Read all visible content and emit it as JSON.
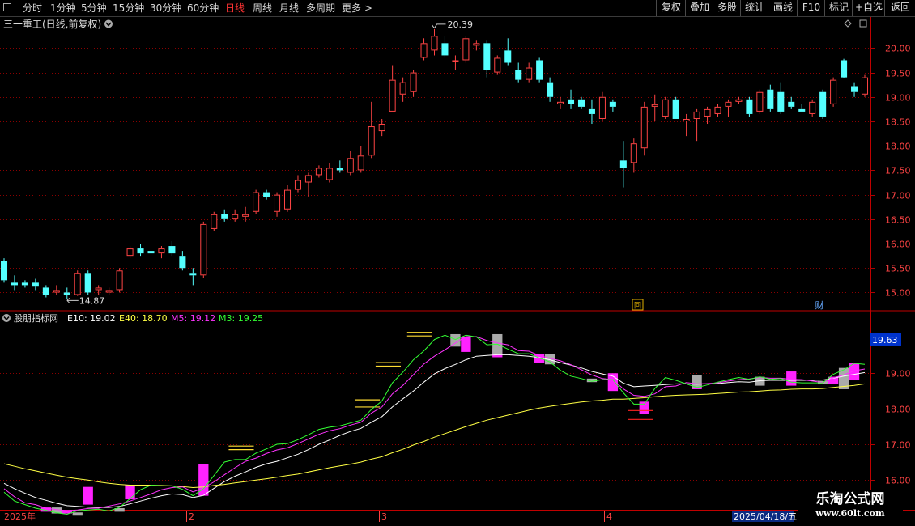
{
  "toolbar": {
    "left": [
      "分时",
      "1分钟",
      "5分钟",
      "15分钟",
      "30分钟",
      "60分钟",
      "日线",
      "周线",
      "月线",
      "多周期",
      "更多 >"
    ],
    "active": "日线",
    "right": [
      "复权",
      "叠加",
      "多股",
      "统计",
      "画线",
      "F10",
      "标记",
      "+自选",
      "返回"
    ]
  },
  "main_panel": {
    "title": "三一重工(日线,前复权)",
    "high_label": "20.39",
    "low_label": "14.87",
    "marker_left": "回",
    "marker_right": "财"
  },
  "indicator_panel": {
    "name": "股朋指标网",
    "legend": [
      {
        "label": "E10: 19.02",
        "color": "#ffffff"
      },
      {
        "label": "E40: 18.70",
        "color": "#ffff44"
      },
      {
        "label": "M5: 19.12",
        "color": "#ff33ff"
      },
      {
        "label": "M3: 19.25",
        "color": "#33ff33"
      }
    ],
    "price_tag": "19.63"
  },
  "x_axis": {
    "labels": [
      "2025年",
      "2",
      "3",
      "4"
    ],
    "date_box": "2025/04/18/五"
  },
  "watermark": {
    "line1": "乐淘公式网",
    "line2": "www.60lt.com"
  },
  "colors": {
    "up": "#ff4444",
    "down": "#54ffff",
    "grid": "#8a0000",
    "frame": "#b00000"
  },
  "chart_data": [
    {
      "type": "candlestick",
      "ylim": [
        14.66,
        20.42
      ],
      "yticks": [
        15.0,
        15.5,
        16.0,
        16.5,
        17.0,
        17.5,
        18.0,
        18.5,
        19.0,
        19.5,
        20.0
      ],
      "ohlc": [
        [
          15.65,
          15.7,
          15.2,
          15.25
        ],
        [
          15.2,
          15.35,
          15.05,
          15.15
        ],
        [
          15.2,
          15.25,
          15.1,
          15.15
        ],
        [
          15.2,
          15.28,
          15.05,
          15.12
        ],
        [
          15.1,
          15.15,
          14.9,
          14.95
        ],
        [
          15.0,
          15.15,
          14.95,
          15.05
        ],
        [
          15.0,
          15.1,
          14.87,
          14.95
        ],
        [
          14.95,
          15.45,
          14.93,
          15.4
        ],
        [
          15.4,
          15.45,
          14.95,
          15.0
        ],
        [
          15.05,
          15.15,
          14.95,
          15.1
        ],
        [
          15.0,
          15.1,
          14.95,
          15.05
        ],
        [
          15.05,
          15.5,
          15.0,
          15.45
        ],
        [
          15.75,
          15.95,
          15.7,
          15.9
        ],
        [
          15.9,
          16.0,
          15.75,
          15.8
        ],
        [
          15.85,
          15.95,
          15.75,
          15.8
        ],
        [
          15.8,
          15.95,
          15.7,
          15.9
        ],
        [
          15.95,
          16.05,
          15.75,
          15.8
        ],
        [
          15.75,
          15.85,
          15.45,
          15.5
        ],
        [
          15.4,
          15.5,
          15.15,
          15.35
        ],
        [
          15.35,
          16.45,
          15.3,
          16.4
        ],
        [
          16.3,
          16.65,
          16.25,
          16.6
        ],
        [
          16.6,
          16.7,
          16.45,
          16.5
        ],
        [
          16.5,
          16.7,
          16.45,
          16.6
        ],
        [
          16.55,
          16.75,
          16.45,
          16.6
        ],
        [
          16.65,
          17.1,
          16.6,
          17.05
        ],
        [
          17.05,
          17.1,
          16.9,
          16.95
        ],
        [
          16.65,
          17.05,
          16.55,
          17.0
        ],
        [
          16.7,
          17.2,
          16.65,
          17.1
        ],
        [
          17.1,
          17.4,
          17.05,
          17.3
        ],
        [
          17.25,
          17.45,
          16.95,
          17.4
        ],
        [
          17.4,
          17.6,
          17.35,
          17.55
        ],
        [
          17.3,
          17.65,
          17.25,
          17.55
        ],
        [
          17.55,
          17.7,
          17.45,
          17.5
        ],
        [
          17.45,
          17.9,
          17.4,
          17.75
        ],
        [
          17.5,
          18.0,
          17.45,
          17.8
        ],
        [
          17.8,
          18.9,
          17.75,
          18.4
        ],
        [
          18.3,
          18.55,
          18.2,
          18.45
        ],
        [
          18.7,
          19.65,
          18.7,
          19.35
        ],
        [
          19.05,
          19.4,
          18.9,
          19.3
        ],
        [
          19.1,
          19.55,
          19.0,
          19.5
        ],
        [
          19.8,
          20.2,
          19.75,
          20.1
        ],
        [
          19.95,
          20.39,
          19.85,
          20.25
        ],
        [
          20.1,
          20.25,
          19.8,
          19.85
        ],
        [
          19.75,
          19.85,
          19.55,
          19.75
        ],
        [
          19.75,
          20.25,
          19.7,
          20.2
        ],
        [
          20.05,
          20.15,
          19.95,
          20.1
        ],
        [
          20.1,
          20.15,
          19.4,
          19.55
        ],
        [
          19.5,
          19.85,
          19.45,
          19.8
        ],
        [
          19.95,
          20.2,
          19.65,
          19.7
        ],
        [
          19.55,
          19.7,
          19.3,
          19.35
        ],
        [
          19.35,
          19.7,
          19.3,
          19.6
        ],
        [
          19.75,
          19.8,
          19.3,
          19.35
        ],
        [
          19.3,
          19.4,
          18.9,
          19.0
        ],
        [
          18.85,
          19.0,
          18.75,
          18.9
        ],
        [
          18.95,
          19.15,
          18.75,
          18.85
        ],
        [
          18.95,
          19.0,
          18.75,
          18.8
        ],
        [
          18.75,
          18.95,
          18.45,
          18.65
        ],
        [
          18.55,
          19.1,
          18.5,
          19.0
        ],
        [
          18.9,
          18.95,
          18.7,
          18.8
        ],
        [
          17.7,
          18.1,
          17.15,
          17.55
        ],
        [
          17.65,
          18.15,
          17.45,
          18.05
        ],
        [
          17.95,
          18.9,
          17.8,
          18.8
        ],
        [
          18.8,
          19.05,
          18.5,
          18.85
        ],
        [
          18.6,
          19.0,
          18.55,
          18.95
        ],
        [
          18.95,
          19.0,
          18.55,
          18.55
        ],
        [
          18.5,
          18.65,
          18.2,
          18.55
        ],
        [
          18.55,
          18.75,
          18.1,
          18.7
        ],
        [
          18.6,
          18.8,
          18.45,
          18.75
        ],
        [
          18.65,
          18.85,
          18.6,
          18.8
        ],
        [
          18.8,
          18.95,
          18.6,
          18.9
        ],
        [
          18.9,
          19.0,
          18.85,
          18.95
        ],
        [
          18.95,
          19.0,
          18.6,
          18.65
        ],
        [
          18.7,
          19.15,
          18.65,
          19.1
        ],
        [
          19.15,
          19.25,
          18.7,
          18.75
        ],
        [
          19.1,
          19.3,
          18.65,
          18.7
        ],
        [
          18.9,
          19.0,
          18.75,
          18.8
        ],
        [
          18.75,
          18.85,
          18.7,
          18.7
        ],
        [
          18.65,
          18.95,
          18.6,
          18.9
        ],
        [
          19.1,
          19.15,
          18.55,
          18.6
        ],
        [
          18.85,
          19.4,
          18.8,
          19.35
        ],
        [
          19.75,
          19.78,
          19.38,
          19.4
        ],
        [
          19.22,
          19.3,
          19.0,
          19.1
        ],
        [
          19.05,
          19.45,
          19.0,
          19.4
        ]
      ]
    },
    {
      "type": "line",
      "ylim": [
        15.2,
        20.35
      ],
      "yticks": [
        16.0,
        17.0,
        18.0,
        19.0
      ],
      "series": [
        {
          "name": "E10",
          "color": "#ffffff",
          "values": [
            15.9,
            15.75,
            15.62,
            15.5,
            15.42,
            15.34,
            15.27,
            15.25,
            15.23,
            15.22,
            15.22,
            15.25,
            15.32,
            15.4,
            15.48,
            15.55,
            15.6,
            15.58,
            15.5,
            15.56,
            15.76,
            15.95,
            16.1,
            16.22,
            16.35,
            16.45,
            16.52,
            16.62,
            16.72,
            16.85,
            17.0,
            17.12,
            17.25,
            17.36,
            17.45,
            17.62,
            17.78,
            18.05,
            18.28,
            18.5,
            18.75,
            18.98,
            19.13,
            19.25,
            19.38,
            19.48,
            19.5,
            19.52,
            19.52,
            19.5,
            19.48,
            19.44,
            19.38,
            19.3,
            19.23,
            19.15,
            19.05,
            18.98,
            18.92,
            18.72,
            18.62,
            18.64,
            18.66,
            18.68,
            18.7,
            18.7,
            18.69,
            18.7,
            18.71,
            18.74,
            18.76,
            18.75,
            18.79,
            18.8,
            18.8,
            18.8,
            18.8,
            18.8,
            18.81,
            18.86,
            18.92,
            18.97,
            19.02
          ]
        },
        {
          "name": "E40",
          "color": "#ffff44",
          "values": [
            16.45,
            16.38,
            16.31,
            16.25,
            16.19,
            16.13,
            16.07,
            16.03,
            15.99,
            15.94,
            15.9,
            15.87,
            15.85,
            15.85,
            15.85,
            15.84,
            15.83,
            15.81,
            15.78,
            15.8,
            15.84,
            15.87,
            15.91,
            15.95,
            15.99,
            16.03,
            16.07,
            16.12,
            16.16,
            16.22,
            16.28,
            16.34,
            16.39,
            16.44,
            16.5,
            16.58,
            16.65,
            16.76,
            16.86,
            16.98,
            17.08,
            17.2,
            17.3,
            17.4,
            17.5,
            17.59,
            17.68,
            17.75,
            17.82,
            17.89,
            17.96,
            18.02,
            18.07,
            18.11,
            18.15,
            18.19,
            18.22,
            18.24,
            18.27,
            18.27,
            18.29,
            18.31,
            18.34,
            18.36,
            18.38,
            18.39,
            18.4,
            18.41,
            18.43,
            18.45,
            18.47,
            18.48,
            18.5,
            18.52,
            18.53,
            18.55,
            18.56,
            18.56,
            18.57,
            18.6,
            18.63,
            18.66,
            18.7
          ]
        },
        {
          "name": "M5",
          "color": "#ff33ff",
          "values": [
            15.75,
            15.52,
            15.35,
            15.3,
            15.2,
            15.16,
            15.13,
            15.15,
            15.19,
            15.2,
            15.26,
            15.32,
            15.4,
            15.5,
            15.6,
            15.72,
            15.78,
            15.8,
            15.66,
            15.77,
            15.94,
            16.14,
            16.34,
            16.52,
            16.61,
            16.74,
            16.84,
            16.9,
            17.02,
            17.15,
            17.28,
            17.38,
            17.44,
            17.54,
            17.62,
            17.88,
            18.05,
            18.42,
            18.66,
            18.96,
            19.26,
            19.48,
            19.66,
            19.85,
            20.03,
            20.03,
            19.92,
            19.85,
            19.8,
            19.64,
            19.62,
            19.5,
            19.42,
            19.35,
            19.24,
            19.1,
            18.95,
            18.85,
            18.82,
            18.56,
            18.38,
            18.35,
            18.42,
            18.62,
            18.64,
            18.74,
            18.7,
            18.71,
            18.73,
            18.78,
            18.82,
            18.84,
            18.88,
            18.86,
            18.86,
            18.83,
            18.82,
            18.78,
            18.74,
            18.87,
            18.95,
            19.07,
            19.12
          ]
        },
        {
          "name": "M3",
          "color": "#33ff33",
          "values": [
            15.65,
            15.4,
            15.3,
            15.2,
            15.14,
            15.07,
            15.03,
            15.13,
            15.15,
            15.17,
            15.12,
            15.22,
            15.47,
            15.72,
            15.85,
            15.83,
            15.83,
            15.73,
            15.55,
            15.75,
            16.12,
            16.5,
            16.57,
            16.57,
            16.75,
            16.87,
            17.0,
            17.02,
            17.13,
            17.27,
            17.42,
            17.48,
            17.52,
            17.6,
            17.68,
            17.98,
            18.22,
            18.73,
            19.03,
            19.38,
            19.63,
            19.95,
            20.07,
            19.95,
            20.07,
            20.02,
            19.8,
            19.82,
            19.68,
            19.55,
            19.55,
            19.43,
            19.32,
            19.08,
            18.92,
            18.85,
            18.77,
            18.82,
            18.82,
            18.45,
            18.13,
            18.13,
            18.57,
            18.88,
            18.8,
            18.7,
            18.6,
            18.67,
            18.75,
            18.82,
            18.88,
            18.83,
            18.9,
            18.83,
            18.85,
            18.75,
            18.73,
            18.73,
            18.73,
            18.97,
            19.1,
            19.28,
            19.25
          ]
        }
      ],
      "markers": [
        {
          "i": 4,
          "type": "pink",
          "low": 15.1,
          "high": 15.22
        },
        {
          "i": 6,
          "type": "pink",
          "low": 15.05,
          "high": 15.15
        },
        {
          "i": 8,
          "type": "pink",
          "low": 15.3,
          "high": 15.8
        },
        {
          "i": 12,
          "type": "pink",
          "low": 15.45,
          "high": 15.85
        },
        {
          "i": 19,
          "type": "pink",
          "low": 15.55,
          "high": 16.45
        },
        {
          "i": 44,
          "type": "pink",
          "low": 19.6,
          "high": 20.03
        },
        {
          "i": 47,
          "type": "pink",
          "low": 19.45,
          "high": 19.7
        },
        {
          "i": 51,
          "type": "pink",
          "low": 19.3,
          "high": 19.55
        },
        {
          "i": 58,
          "type": "pink",
          "low": 18.5,
          "high": 19.0
        },
        {
          "i": 61,
          "type": "pink",
          "low": 17.85,
          "high": 18.2
        },
        {
          "i": 66,
          "type": "pink",
          "low": 18.55,
          "high": 18.7
        },
        {
          "i": 75,
          "type": "pink",
          "low": 18.65,
          "high": 19.05
        },
        {
          "i": 79,
          "type": "pink",
          "low": 18.7,
          "high": 18.9
        },
        {
          "i": 81,
          "type": "pink",
          "low": 18.8,
          "high": 19.3
        },
        {
          "i": 5,
          "type": "gray",
          "low": 15.05,
          "high": 15.22
        },
        {
          "i": 7,
          "type": "gray",
          "low": 15.0,
          "high": 15.08
        },
        {
          "i": 11,
          "type": "gray",
          "low": 15.1,
          "high": 15.2
        },
        {
          "i": 43,
          "type": "gray",
          "low": 19.75,
          "high": 20.1
        },
        {
          "i": 47,
          "type": "gray",
          "low": 19.55,
          "high": 20.1
        },
        {
          "i": 52,
          "type": "gray",
          "low": 19.25,
          "high": 19.55
        },
        {
          "i": 56,
          "type": "gray",
          "low": 18.75,
          "high": 18.85
        },
        {
          "i": 66,
          "type": "gray",
          "low": 18.6,
          "high": 18.95
        },
        {
          "i": 72,
          "type": "gray",
          "low": 18.65,
          "high": 18.9
        },
        {
          "i": 78,
          "type": "gray",
          "low": 18.7,
          "high": 18.78
        },
        {
          "i": 80,
          "type": "gray",
          "low": 18.55,
          "high": 19.15
        },
        {
          "i": 61,
          "type": "red_line",
          "low": 17.7,
          "high": 17.7
        },
        {
          "i": 61,
          "type": "red_line",
          "low": 17.95,
          "high": 17.95
        },
        {
          "i": 23,
          "type": "yellow_line",
          "low": 16.85,
          "high": 16.85
        },
        {
          "i": 23,
          "type": "yellow_line",
          "low": 16.95,
          "high": 16.95
        },
        {
          "i": 35,
          "type": "yellow_line",
          "low": 18.05,
          "high": 18.05
        },
        {
          "i": 35,
          "type": "yellow_line",
          "low": 18.25,
          "high": 18.25
        },
        {
          "i": 37,
          "type": "yellow_line",
          "low": 19.2,
          "high": 19.2
        },
        {
          "i": 37,
          "type": "yellow_line",
          "low": 19.3,
          "high": 19.3
        },
        {
          "i": 40,
          "type": "yellow_line",
          "low": 20.05,
          "high": 20.05
        },
        {
          "i": 40,
          "type": "yellow_line",
          "low": 20.15,
          "high": 20.15
        }
      ]
    }
  ]
}
